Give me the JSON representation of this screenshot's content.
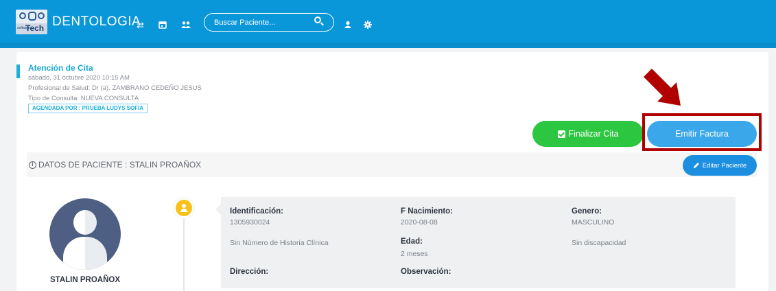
{
  "app": {
    "brand": "DENTOLOGIA",
    "logo_text": "Tech",
    "logo_subtext": "software"
  },
  "toolbar": {
    "icons": [
      "exchange-icon",
      "calendar-icon",
      "users-icon",
      "user-icon",
      "gear-icon"
    ],
    "search_placeholder": "Buscar Paciente..."
  },
  "appointment": {
    "title": "Atención de Cita",
    "datetime": "sábado, 31 octubre 2020 10:15 AM",
    "professional": "Profesional de Salud: Dr (a). ZAMBRANO CEDEÑO JESUS",
    "consult_type": "Tipo de Consulta: NUEVA CONSULTA",
    "scheduled_by": "AGENDADA POR : PRUEBA LUDYS SOFIA"
  },
  "actions": {
    "finish_label": "Finalizar Cita",
    "invoice_label": "Emitir Factura"
  },
  "patient_section": {
    "title": "DATOS DE PACIENTE : STALIN PROAÑOX",
    "edit_label": "Editar Paciente"
  },
  "patient": {
    "name": "STALIN PROAÑOX",
    "id_label": "Identificación:",
    "id_value": "1305930024",
    "birth_label": "F Nacimiento:",
    "birth_value": "2020-08-08",
    "gender_label": "Genero:",
    "gender_value": "MASCULINO",
    "history_text": "Sin Número de Historia Clínica",
    "age_label": "Edad:",
    "age_value": "2 meses",
    "disability_text": "Sin discapacidad",
    "address_label": "Dirección:",
    "observation_label": "Observación:"
  },
  "colors": {
    "topbar": "#0a97d9",
    "accent": "#19a9d4",
    "finish_button": "#2dc640",
    "invoice_button": "#3aa7ea",
    "highlight": "#b00000",
    "timeline_dot": "#f9c11a"
  }
}
